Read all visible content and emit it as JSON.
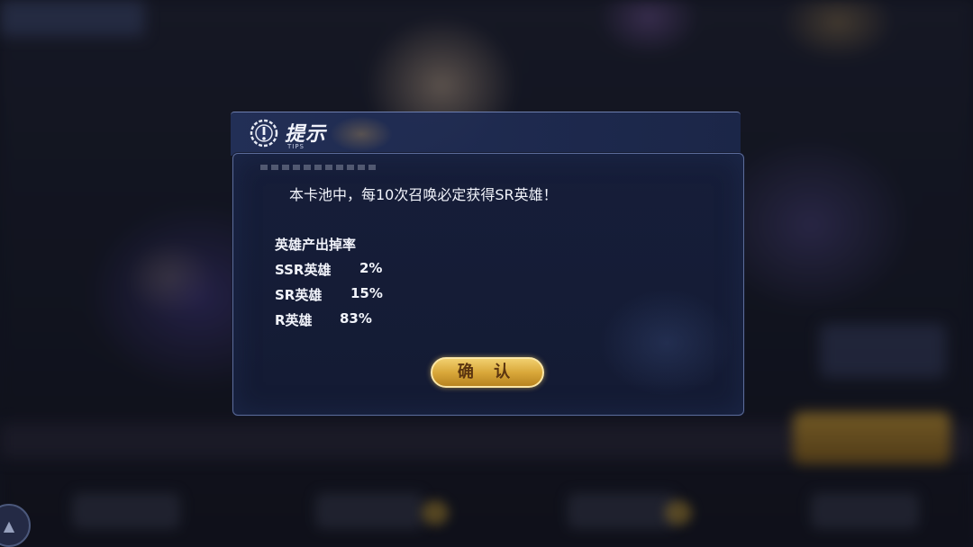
{
  "dialog": {
    "title": "提示",
    "title_sub": "TIPS",
    "line1": "本卡池中，每10次召唤必定获得SR英雄！",
    "rate_title": "英雄产出掉率",
    "rates": [
      {
        "name": "SSR英雄",
        "value": "2%"
      },
      {
        "name": "SR英雄",
        "value": "15%"
      },
      {
        "name": "R英雄",
        "value": "83%"
      }
    ],
    "confirm_label": "确 认"
  },
  "colors": {
    "panel": "#161e3a",
    "border": "#5c6c9a",
    "button_gold": "#d9a83a",
    "text": "#f2f4fb"
  }
}
